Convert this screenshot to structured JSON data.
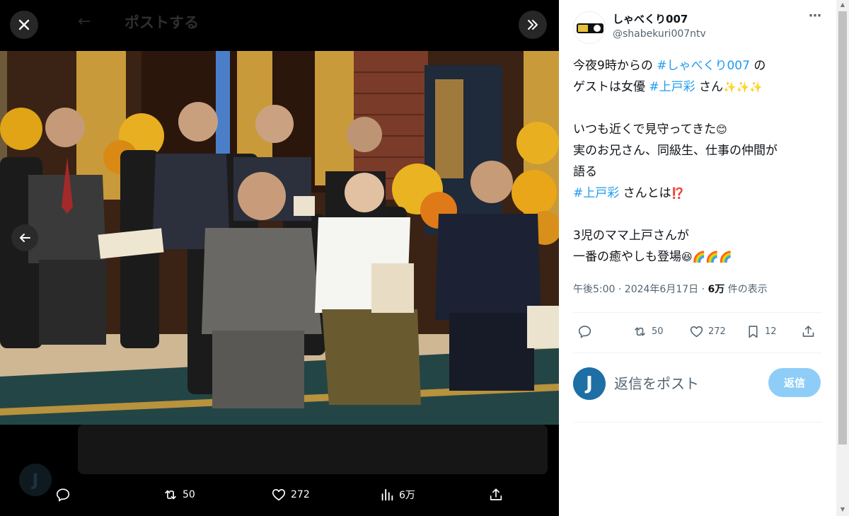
{
  "background": {
    "header_title": "ポストする",
    "back_arrow": "←"
  },
  "viewer": {
    "close_icon": "close-icon",
    "expand_icon": "chevron-double-right-icon",
    "prev_icon": "arrow-left-icon",
    "actions": {
      "reply_count": "",
      "retweet_count": "50",
      "like_count": "272",
      "views_count": "6万"
    }
  },
  "tweet": {
    "author_name": "しゃべくり007",
    "author_handle": "@shabekuri007ntv",
    "lines": [
      [
        {
          "t": "今夜9時からの "
        },
        {
          "t": "#しゃべくり007",
          "tag": true
        },
        {
          "t": " の"
        }
      ],
      [
        {
          "t": "ゲストは女優 "
        },
        {
          "t": "#上戸彩",
          "tag": true
        },
        {
          "t": " さん"
        },
        {
          "t": "✨✨✨",
          "emo": true
        }
      ],
      [
        {
          "t": ""
        }
      ],
      [
        {
          "t": "いつも近くで見守ってきた"
        },
        {
          "t": "😊",
          "emo": true
        }
      ],
      [
        {
          "t": "実のお兄さん、同級生、仕事の仲間が"
        }
      ],
      [
        {
          "t": "語る"
        }
      ],
      [
        {
          "t": "#上戸彩",
          "tag": true
        },
        {
          "t": " さんとは"
        },
        {
          "t": "⁉️",
          "emo": true
        }
      ],
      [
        {
          "t": ""
        }
      ],
      [
        {
          "t": "3児のママ上戸さんが"
        }
      ],
      [
        {
          "t": "一番の癒やしも登場"
        },
        {
          "t": "😆🌈🌈🌈",
          "emo": true
        }
      ]
    ],
    "meta_time": "午後5:00 · 2024年6月17日 · ",
    "meta_views": "6万",
    "meta_suffix": " 件の表示",
    "actions": {
      "retweet_count": "50",
      "like_count": "272",
      "bookmark_count": "12"
    },
    "reply_placeholder": "返信をポスト",
    "reply_button": "返信",
    "reply_avatar_letter": "J"
  },
  "colors": {
    "accent": "#1d9bf0",
    "reply_button": "#8ecdf8",
    "viewer_bg": "#000000"
  }
}
